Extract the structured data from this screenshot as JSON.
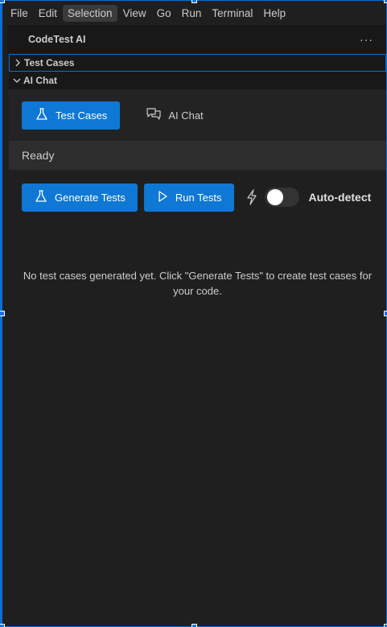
{
  "menubar": {
    "items": [
      "File",
      "Edit",
      "Selection",
      "View",
      "Go",
      "Run",
      "Terminal",
      "Help"
    ],
    "active_index": 2
  },
  "panel": {
    "title": "CodeTest AI",
    "more_icon": "ellipsis-icon"
  },
  "sections": {
    "test_cases": "Test Cases",
    "ai_chat": "AI Chat"
  },
  "tabs": {
    "test_cases_label": "Test Cases",
    "ai_chat_label": "AI Chat"
  },
  "status": "Ready",
  "actions": {
    "generate_label": "Generate Tests",
    "run_label": "Run Tests",
    "auto_detect_label": "Auto-detect",
    "auto_detect_on": false
  },
  "empty_message": "No test cases generated yet. Click \"Generate Tests\" to create test cases for your code.",
  "colors": {
    "accent": "#0e78d4",
    "background": "#1f1f1f",
    "status_bar": "#2d2d2d"
  }
}
